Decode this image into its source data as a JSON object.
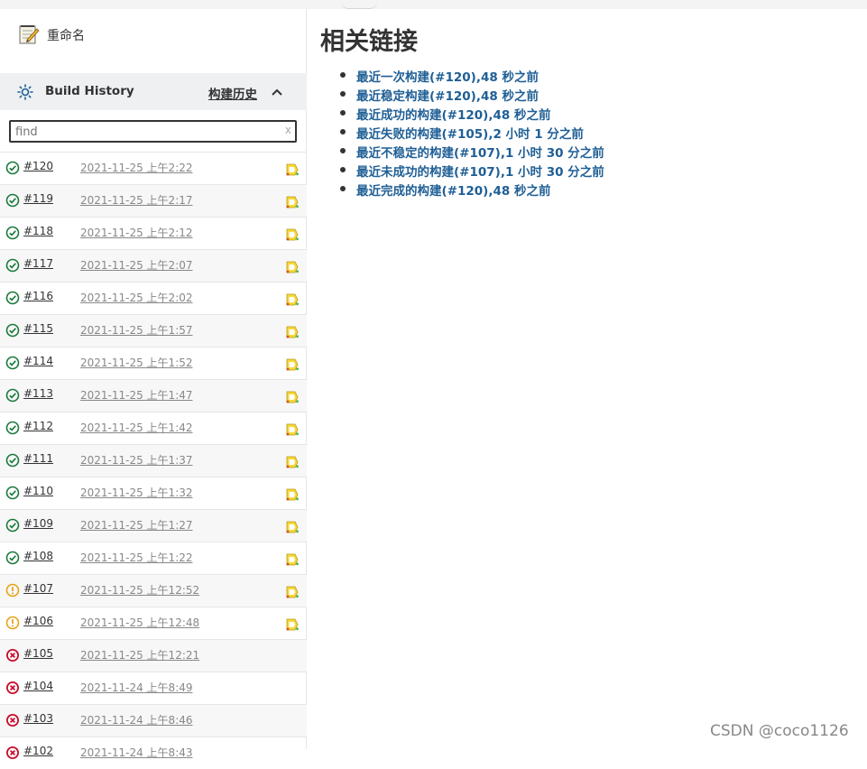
{
  "sidebar": {
    "rename_label": "重命名",
    "build_history": {
      "title": "Build History",
      "trend_label": "构建历史",
      "search_placeholder": "find",
      "clear_label": "x"
    },
    "builds": [
      {
        "number": "#120",
        "date": "2021-11-25 上午2:22",
        "status": "success",
        "console": true
      },
      {
        "number": "#119",
        "date": "2021-11-25 上午2:17",
        "status": "success",
        "console": true
      },
      {
        "number": "#118",
        "date": "2021-11-25 上午2:12",
        "status": "success",
        "console": true
      },
      {
        "number": "#117",
        "date": "2021-11-25 上午2:07",
        "status": "success",
        "console": true
      },
      {
        "number": "#116",
        "date": "2021-11-25 上午2:02",
        "status": "success",
        "console": true
      },
      {
        "number": "#115",
        "date": "2021-11-25 上午1:57",
        "status": "success",
        "console": true
      },
      {
        "number": "#114",
        "date": "2021-11-25 上午1:52",
        "status": "success",
        "console": true
      },
      {
        "number": "#113",
        "date": "2021-11-25 上午1:47",
        "status": "success",
        "console": true
      },
      {
        "number": "#112",
        "date": "2021-11-25 上午1:42",
        "status": "success",
        "console": true
      },
      {
        "number": "#111",
        "date": "2021-11-25 上午1:37",
        "status": "success",
        "console": true
      },
      {
        "number": "#110",
        "date": "2021-11-25 上午1:32",
        "status": "success",
        "console": true
      },
      {
        "number": "#109",
        "date": "2021-11-25 上午1:27",
        "status": "success",
        "console": true
      },
      {
        "number": "#108",
        "date": "2021-11-25 上午1:22",
        "status": "success",
        "console": true
      },
      {
        "number": "#107",
        "date": "2021-11-25 上午12:52",
        "status": "unstable",
        "console": true
      },
      {
        "number": "#106",
        "date": "2021-11-25 上午12:48",
        "status": "unstable",
        "console": true
      },
      {
        "number": "#105",
        "date": "2021-11-25 上午12:21",
        "status": "failed",
        "console": false
      },
      {
        "number": "#104",
        "date": "2021-11-24 上午8:49",
        "status": "failed",
        "console": false
      },
      {
        "number": "#103",
        "date": "2021-11-24 上午8:46",
        "status": "failed",
        "console": false
      },
      {
        "number": "#102",
        "date": "2021-11-24 上午8:43",
        "status": "failed",
        "console": false
      }
    ]
  },
  "main": {
    "title": "相关链接",
    "links": [
      "最近一次构建(#120),48 秒之前",
      "最近稳定构建(#120),48 秒之前",
      "最近成功的构建(#120),48 秒之前",
      "最近失败的构建(#105),2 小时 1 分之前",
      "最近不稳定的构建(#107),1 小时 30 分之前",
      "最近未成功的构建(#107),1 小时 30 分之前",
      "最近完成的构建(#120),48 秒之前"
    ]
  },
  "watermark": "CSDN @coco1126",
  "colors": {
    "success": "#1b7a3c",
    "unstable": "#e8a317",
    "failed": "#c8102e",
    "link": "#1f5f95"
  }
}
